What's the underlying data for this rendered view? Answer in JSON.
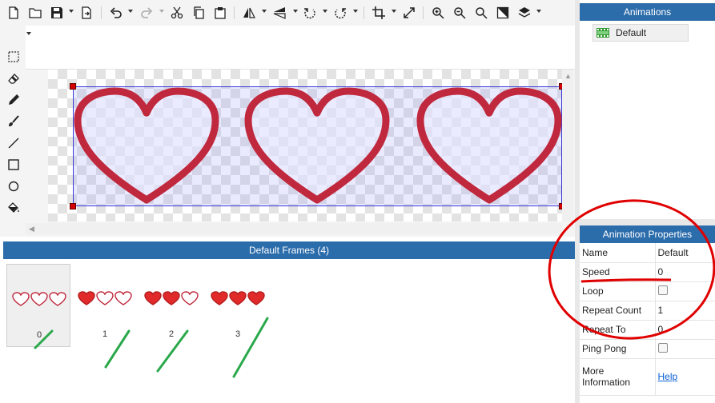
{
  "frames_panel": {
    "title": "Default Frames (4)",
    "frames": [
      {
        "number": "0",
        "filled_hearts": 0,
        "selected": true
      },
      {
        "number": "1",
        "filled_hearts": 1,
        "selected": false
      },
      {
        "number": "2",
        "filled_hearts": 2,
        "selected": false
      },
      {
        "number": "3",
        "filled_hearts": 3,
        "selected": false
      }
    ]
  },
  "animations_panel": {
    "title": "Animations",
    "items": [
      {
        "label": "Default"
      }
    ]
  },
  "properties_panel": {
    "title": "Animation Properties",
    "rows": [
      {
        "key": "Name",
        "value": "Default"
      },
      {
        "key": "Speed",
        "value": "0"
      },
      {
        "key": "Loop",
        "checkbox": false
      },
      {
        "key": "Repeat Count",
        "value": "1"
      },
      {
        "key": "Repeat To",
        "value": "0"
      },
      {
        "key": "Ping Pong",
        "checkbox": false
      },
      {
        "key": "More Information",
        "link": "Help"
      }
    ]
  },
  "colors": {
    "panel_header": "#2b6cab",
    "heart_outline": "#c0283d",
    "heart_fill": "#e12b2b",
    "selection": "#3b3bd6",
    "handle": "#d40000",
    "annotation_red": "#e00000",
    "annotation_green": "#2aa84a"
  },
  "icons": {
    "toolbar": [
      "new-file-icon",
      "open-folder-icon",
      "save-icon",
      "export-icon",
      "undo-icon",
      "redo-icon",
      "cut-icon",
      "copy-icon",
      "paste-icon",
      "flip-horizontal-icon",
      "flip-vertical-icon",
      "rotate-left-icon",
      "rotate-right-icon",
      "crop-icon",
      "resize-icon",
      "zoom-in-icon",
      "zoom-out-icon",
      "zoom-reset-icon",
      "color-icon",
      "layers-icon",
      "grid-icon"
    ],
    "tools": [
      "marquee-select-icon",
      "eraser-icon",
      "pencil-icon",
      "brush-icon",
      "line-icon",
      "rectangle-icon",
      "ellipse-icon",
      "fill-bucket-icon"
    ]
  }
}
